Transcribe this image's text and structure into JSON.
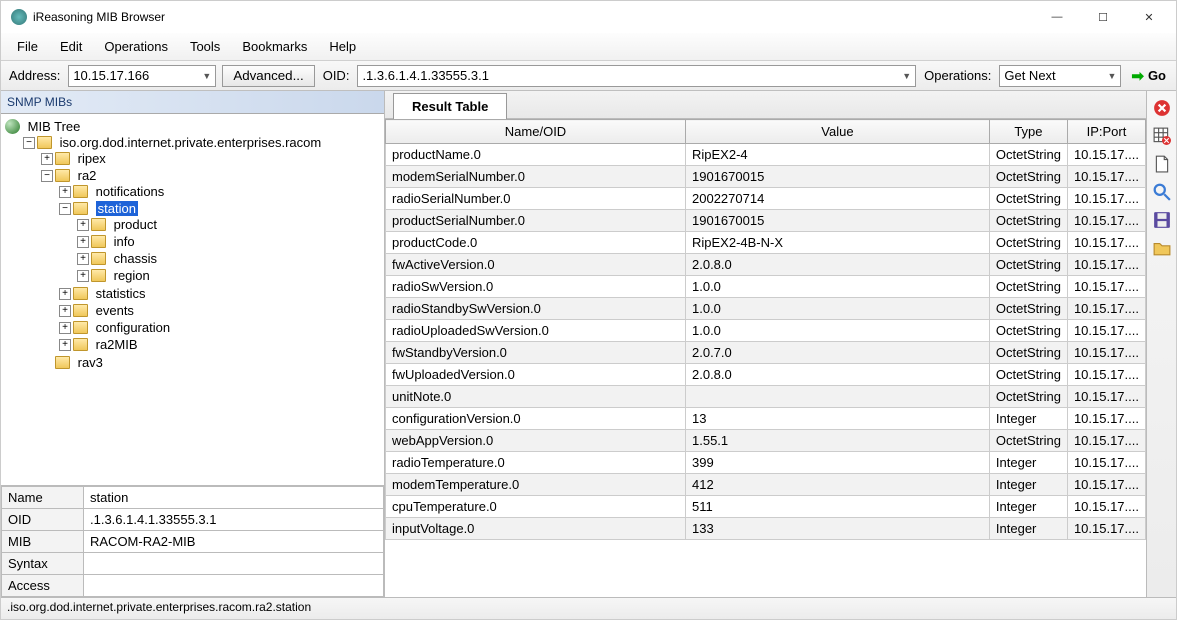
{
  "window": {
    "title": "iReasoning MIB Browser"
  },
  "menus": [
    "File",
    "Edit",
    "Operations",
    "Tools",
    "Bookmarks",
    "Help"
  ],
  "toolbar": {
    "addressLabel": "Address:",
    "addressValue": "10.15.17.166",
    "advanced": "Advanced...",
    "oidLabel": "OID:",
    "oidValue": ".1.3.6.1.4.1.33555.3.1",
    "operationsLabel": "Operations:",
    "operationsValue": "Get Next",
    "go": "Go"
  },
  "leftHeader": "SNMP MIBs",
  "tree": {
    "root": "MIB Tree",
    "l1": "iso.org.dod.internet.private.enterprises.racom",
    "ripex": "ripex",
    "ra2": "ra2",
    "notifications": "notifications",
    "station": "station",
    "product": "product",
    "info": "info",
    "chassis": "chassis",
    "region": "region",
    "statistics": "statistics",
    "events": "events",
    "configuration": "configuration",
    "ra2mib": "ra2MIB",
    "rav3": "rav3"
  },
  "details": {
    "nameLabel": "Name",
    "nameVal": "station",
    "oidLabel": "OID",
    "oidVal": ".1.3.6.1.4.1.33555.3.1",
    "mibLabel": "MIB",
    "mibVal": "RACOM-RA2-MIB",
    "syntaxLabel": "Syntax",
    "syntaxVal": "",
    "accessLabel": "Access",
    "accessVal": ""
  },
  "resultTab": "Result Table",
  "resultCols": {
    "name": "Name/OID",
    "value": "Value",
    "type": "Type",
    "ipport": "IP:Port"
  },
  "rows": [
    {
      "name": "productName.0",
      "value": "RipEX2-4",
      "type": "OctetString",
      "ip": "10.15.17...."
    },
    {
      "name": "modemSerialNumber.0",
      "value": "1901670015",
      "type": "OctetString",
      "ip": "10.15.17...."
    },
    {
      "name": "radioSerialNumber.0",
      "value": "2002270714",
      "type": "OctetString",
      "ip": "10.15.17...."
    },
    {
      "name": "productSerialNumber.0",
      "value": "1901670015",
      "type": "OctetString",
      "ip": "10.15.17...."
    },
    {
      "name": "productCode.0",
      "value": "RipEX2-4B-N-X",
      "type": "OctetString",
      "ip": "10.15.17...."
    },
    {
      "name": "fwActiveVersion.0",
      "value": "2.0.8.0",
      "type": "OctetString",
      "ip": "10.15.17...."
    },
    {
      "name": "radioSwVersion.0",
      "value": "1.0.0",
      "type": "OctetString",
      "ip": "10.15.17...."
    },
    {
      "name": "radioStandbySwVersion.0",
      "value": "1.0.0",
      "type": "OctetString",
      "ip": "10.15.17...."
    },
    {
      "name": "radioUploadedSwVersion.0",
      "value": "1.0.0",
      "type": "OctetString",
      "ip": "10.15.17...."
    },
    {
      "name": "fwStandbyVersion.0",
      "value": "2.0.7.0",
      "type": "OctetString",
      "ip": "10.15.17...."
    },
    {
      "name": "fwUploadedVersion.0",
      "value": "2.0.8.0",
      "type": "OctetString",
      "ip": "10.15.17...."
    },
    {
      "name": "unitNote.0",
      "value": "",
      "type": "OctetString",
      "ip": "10.15.17...."
    },
    {
      "name": "configurationVersion.0",
      "value": "13",
      "type": "Integer",
      "ip": "10.15.17...."
    },
    {
      "name": "webAppVersion.0",
      "value": "1.55.1",
      "type": "OctetString",
      "ip": "10.15.17...."
    },
    {
      "name": "radioTemperature.0",
      "value": "399",
      "type": "Integer",
      "ip": "10.15.17...."
    },
    {
      "name": "modemTemperature.0",
      "value": "412",
      "type": "Integer",
      "ip": "10.15.17...."
    },
    {
      "name": "cpuTemperature.0",
      "value": "511",
      "type": "Integer",
      "ip": "10.15.17...."
    },
    {
      "name": "inputVoltage.0",
      "value": "133",
      "type": "Integer",
      "ip": "10.15.17...."
    }
  ],
  "statusbar": ".iso.org.dod.internet.private.enterprises.racom.ra2.station"
}
